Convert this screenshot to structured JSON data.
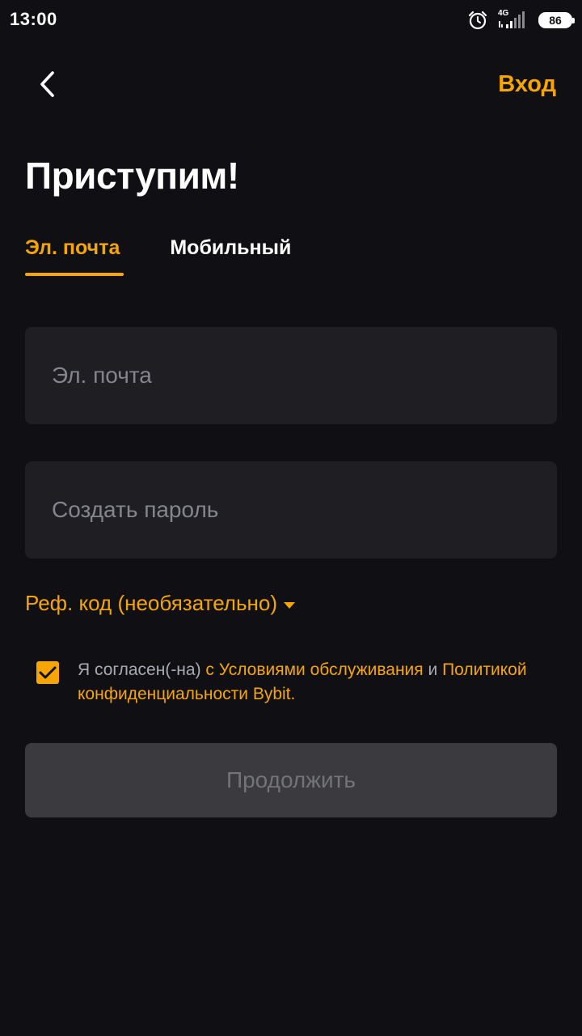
{
  "status_bar": {
    "time": "13:00",
    "network": "4G",
    "battery": "86",
    "icons": [
      "alarm-icon",
      "signal-icon",
      "battery-icon"
    ]
  },
  "header": {
    "back_icon": "chevron-left-icon",
    "login_label": "Вход"
  },
  "title": "Приступим!",
  "tabs": [
    {
      "label": "Эл. почта",
      "active": true
    },
    {
      "label": "Мобильный",
      "active": false
    }
  ],
  "form": {
    "email_placeholder": "Эл. почта",
    "password_placeholder": "Создать пароль",
    "email_value": "",
    "password_value": "",
    "ref_code_label": "Реф. код (необязательно)"
  },
  "agreement": {
    "checked": true,
    "prefix": "Я согласен(-на) ",
    "terms_link": "с Условиями обслуживания",
    "middle": " и ",
    "privacy_link": "Политикой конфиденциальности Bybit",
    "suffix": "."
  },
  "continue_label": "Продолжить",
  "colors": {
    "background": "#101014",
    "accent": "#f7a600",
    "field_bg": "#1e1e23",
    "placeholder": "#84868b",
    "button_disabled_bg": "#3a3a3f",
    "button_disabled_text": "#737478"
  }
}
